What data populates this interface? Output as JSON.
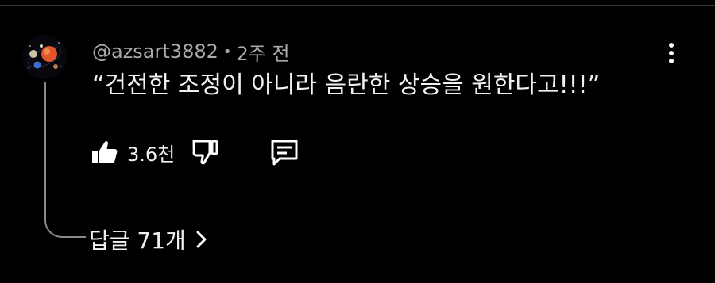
{
  "comment": {
    "author": "@azsart3882",
    "separator": "•",
    "time_ago": "2주 전",
    "text": "“건전한 조정이 아니라 음란한 상승을 원한다고!!!”",
    "like_count": "3.6천",
    "replies_label": "답글 71개"
  },
  "icons": {
    "avatar": "avatar-planets",
    "more": "more-vertical-icon",
    "like": "thumbs-up-icon",
    "dislike": "thumbs-down-icon",
    "reply": "comment-icon",
    "chevron": "chevron-right-icon"
  },
  "colors": {
    "background": "#000000",
    "text_primary": "#f1f1f1",
    "text_secondary": "#aaaaaa",
    "thread_line": "#8a8a8a"
  }
}
